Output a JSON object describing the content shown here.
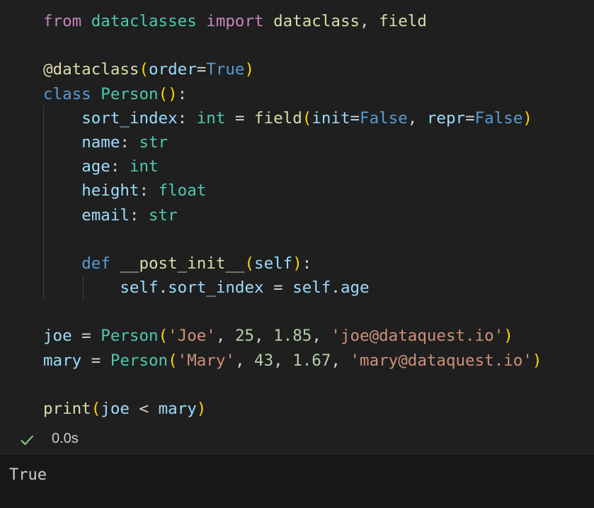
{
  "colors": {
    "background": "#1f1f1f",
    "output_background": "#181818",
    "keyword_control": "#c586c0",
    "keyword": "#569cd6",
    "class_name": "#4ec9b0",
    "function": "#dcdcaa",
    "variable": "#9cdcfe",
    "string": "#ce9178",
    "number": "#b5cea8",
    "bracket_1": "#ffd700",
    "bracket_2": "#da70d6",
    "text": "#d4d4d4",
    "success": "#89d185"
  },
  "code_lines": [
    [
      [
        "from",
        "keyword_control"
      ],
      [
        " ",
        "text"
      ],
      [
        "dataclasses",
        "class_name"
      ],
      [
        " ",
        "text"
      ],
      [
        "import",
        "keyword_control"
      ],
      [
        " ",
        "text"
      ],
      [
        "dataclass",
        "function"
      ],
      [
        ", ",
        "text"
      ],
      [
        "field",
        "function"
      ]
    ],
    [],
    [
      [
        "@",
        "function"
      ],
      [
        "dataclass",
        "function"
      ],
      [
        "(",
        "bracket_1"
      ],
      [
        "order",
        "variable"
      ],
      [
        "=",
        "text"
      ],
      [
        "True",
        "keyword"
      ],
      [
        ")",
        "bracket_1"
      ]
    ],
    [
      [
        "class",
        "keyword"
      ],
      [
        " ",
        "text"
      ],
      [
        "Person",
        "class_name"
      ],
      [
        "(",
        "bracket_1"
      ],
      [
        ")",
        "bracket_1"
      ],
      [
        ":",
        "text"
      ]
    ],
    [
      [
        "    ",
        "text"
      ],
      [
        "sort_index",
        "variable"
      ],
      [
        ": ",
        "text"
      ],
      [
        "int",
        "class_name"
      ],
      [
        " = ",
        "text"
      ],
      [
        "field",
        "function"
      ],
      [
        "(",
        "bracket_1"
      ],
      [
        "init",
        "variable"
      ],
      [
        "=",
        "text"
      ],
      [
        "False",
        "keyword"
      ],
      [
        ", ",
        "text"
      ],
      [
        "repr",
        "variable"
      ],
      [
        "=",
        "text"
      ],
      [
        "False",
        "keyword"
      ],
      [
        ")",
        "bracket_1"
      ]
    ],
    [
      [
        "    ",
        "text"
      ],
      [
        "name",
        "variable"
      ],
      [
        ": ",
        "text"
      ],
      [
        "str",
        "class_name"
      ]
    ],
    [
      [
        "    ",
        "text"
      ],
      [
        "age",
        "variable"
      ],
      [
        ": ",
        "text"
      ],
      [
        "int",
        "class_name"
      ]
    ],
    [
      [
        "    ",
        "text"
      ],
      [
        "height",
        "variable"
      ],
      [
        ": ",
        "text"
      ],
      [
        "float",
        "class_name"
      ]
    ],
    [
      [
        "    ",
        "text"
      ],
      [
        "email",
        "variable"
      ],
      [
        ": ",
        "text"
      ],
      [
        "str",
        "class_name"
      ]
    ],
    [],
    [
      [
        "    ",
        "text"
      ],
      [
        "def",
        "keyword"
      ],
      [
        " ",
        "text"
      ],
      [
        "__post_init__",
        "function"
      ],
      [
        "(",
        "bracket_1"
      ],
      [
        "self",
        "variable"
      ],
      [
        ")",
        "bracket_1"
      ],
      [
        ":",
        "text"
      ]
    ],
    [
      [
        "        ",
        "text"
      ],
      [
        "self",
        "variable"
      ],
      [
        ".",
        "text"
      ],
      [
        "sort_index",
        "variable"
      ],
      [
        " = ",
        "text"
      ],
      [
        "self",
        "variable"
      ],
      [
        ".",
        "text"
      ],
      [
        "age",
        "variable"
      ]
    ],
    [],
    [
      [
        "joe",
        "variable"
      ],
      [
        " = ",
        "text"
      ],
      [
        "Person",
        "class_name"
      ],
      [
        "(",
        "bracket_1"
      ],
      [
        "'Joe'",
        "string"
      ],
      [
        ", ",
        "text"
      ],
      [
        "25",
        "number"
      ],
      [
        ", ",
        "text"
      ],
      [
        "1.85",
        "number"
      ],
      [
        ", ",
        "text"
      ],
      [
        "'joe@dataquest.io'",
        "string"
      ],
      [
        ")",
        "bracket_1"
      ]
    ],
    [
      [
        "mary",
        "variable"
      ],
      [
        " = ",
        "text"
      ],
      [
        "Person",
        "class_name"
      ],
      [
        "(",
        "bracket_1"
      ],
      [
        "'Mary'",
        "string"
      ],
      [
        ", ",
        "text"
      ],
      [
        "43",
        "number"
      ],
      [
        ", ",
        "text"
      ],
      [
        "1.67",
        "number"
      ],
      [
        ", ",
        "text"
      ],
      [
        "'mary@dataquest.io'",
        "string"
      ],
      [
        ")",
        "bracket_1"
      ]
    ],
    [],
    [
      [
        "print",
        "function"
      ],
      [
        "(",
        "bracket_1"
      ],
      [
        "joe",
        "variable"
      ],
      [
        " < ",
        "text"
      ],
      [
        "mary",
        "variable"
      ],
      [
        ")",
        "bracket_1"
      ]
    ]
  ],
  "status": {
    "icon": "check-icon",
    "duration": "0.0s"
  },
  "output": {
    "text": "True"
  }
}
